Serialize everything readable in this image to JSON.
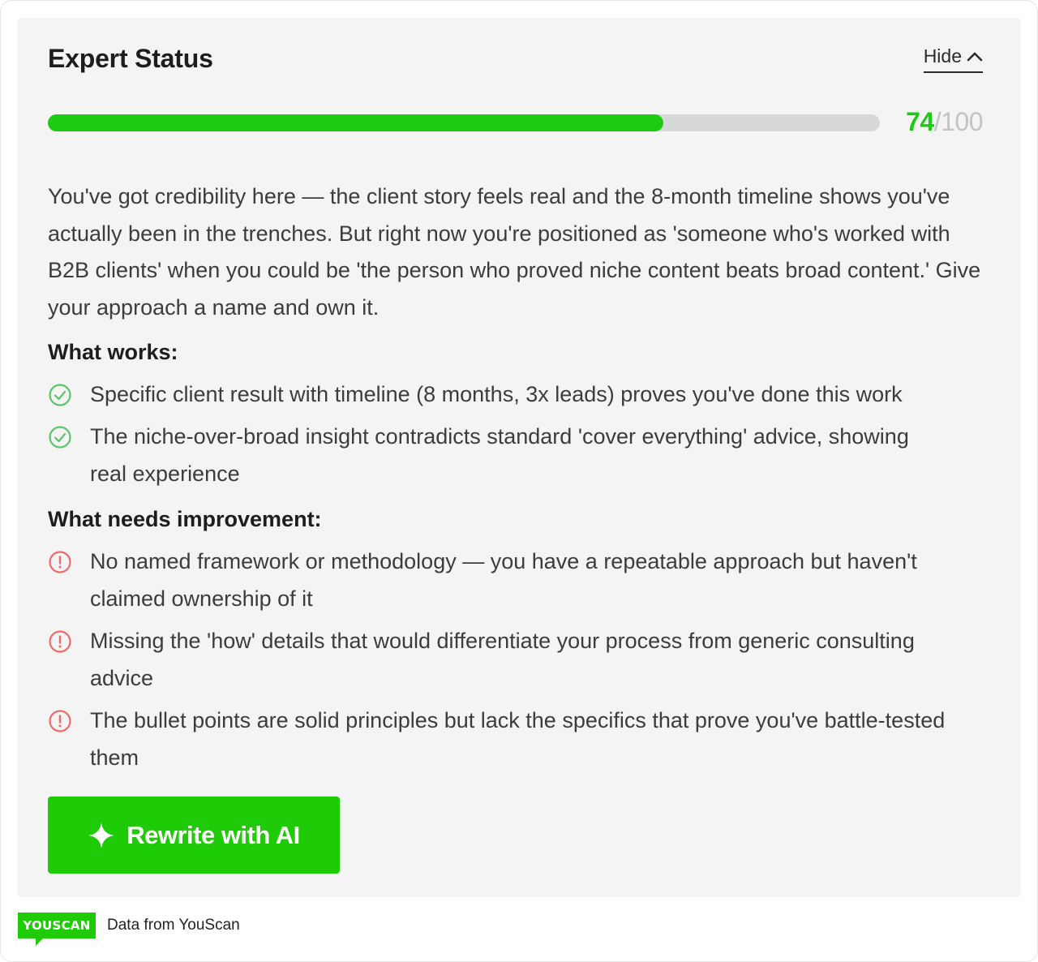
{
  "header": {
    "title": "Expert Status",
    "hide_label": "Hide",
    "hide_icon": "chevron-up-icon"
  },
  "score": {
    "value": "74",
    "separator": "/",
    "max": "100",
    "fraction": 0.74,
    "accent_color": "#1ecb13"
  },
  "summary": "You've got credibility here — the client story feels real and the 8-month timeline shows you've actually been in the trenches. But right now you're positioned as 'someone who's worked with B2B clients' when you could be 'the person who proved niche content beats broad content.' Give your approach a name and own it.",
  "works": {
    "heading": "What works:",
    "icon": "check-circle-icon",
    "items": [
      "Specific client result with timeline (8 months, 3x leads) proves you've done this work",
      "The niche-over-broad insight contradicts standard 'cover everything' advice, showing real experience"
    ]
  },
  "improve": {
    "heading": "What needs improvement:",
    "icon": "alert-circle-icon",
    "items": [
      "No named framework or methodology — you have a repeatable approach but haven't claimed ownership of it",
      "Missing the 'how' details that would differentiate your process from generic consulting advice",
      "The bullet points are solid principles but lack the specifics that prove you've battle-tested them"
    ]
  },
  "action": {
    "label": "Rewrite with AI",
    "icon": "sparkle-icon"
  },
  "footer": {
    "logo_text": "YOUSCAN",
    "text": "Data from YouScan"
  }
}
